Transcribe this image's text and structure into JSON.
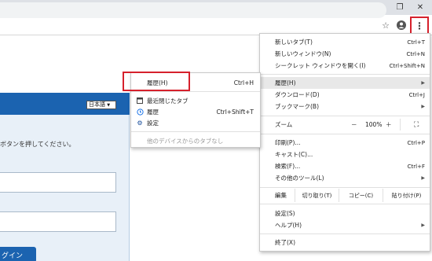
{
  "window": {
    "minimize_icon": "minimize-icon",
    "restore_icon": "restore-icon",
    "close_icon": "close-icon"
  },
  "toolbar": {
    "star_icon": "☆",
    "profile_icon": "●",
    "menu_icon": "⋮"
  },
  "page": {
    "language": "日本語",
    "instruction": "ボタンを押してください。",
    "login_button": "グイン"
  },
  "main_menu": {
    "items": [
      {
        "label": "新しいタブ(T)",
        "shortcut": "Ctrl+T"
      },
      {
        "label": "新しいウィンドウ(N)",
        "shortcut": "Ctrl+N"
      },
      {
        "label": "シークレット ウィンドウを開く(I)",
        "shortcut": "Ctrl+Shift+N"
      },
      {
        "label": "履歴(H)",
        "shortcut": ""
      },
      {
        "label": "ダウンロード(D)",
        "shortcut": "Ctrl+J"
      },
      {
        "label": "ブックマーク(B)",
        "shortcut": ""
      },
      {
        "label": "ズーム",
        "shortcut": ""
      },
      {
        "label": "印刷(P)...",
        "shortcut": "Ctrl+P"
      },
      {
        "label": "キャスト(C)...",
        "shortcut": ""
      },
      {
        "label": "検索(F)...",
        "shortcut": "Ctrl+F"
      },
      {
        "label": "その他のツール(L)",
        "shortcut": ""
      },
      {
        "label": "編集",
        "shortcut": ""
      },
      {
        "label": "設定(S)",
        "shortcut": ""
      },
      {
        "label": "ヘルプ(H)",
        "shortcut": ""
      },
      {
        "label": "終了(X)",
        "shortcut": ""
      }
    ],
    "zoom": {
      "minus": "－",
      "value": "100%",
      "plus": "＋",
      "fullscreen": "⛶"
    },
    "edit": {
      "cut": "切り取り(T)",
      "copy": "コピー(C)",
      "paste": "貼り付け(P)"
    }
  },
  "history_menu": {
    "items": [
      {
        "label": "履歴(H)",
        "shortcut": "Ctrl+H"
      },
      {
        "label": "最近閉じたタブ",
        "shortcut": ""
      },
      {
        "label": "履歴",
        "shortcut": "Ctrl+Shift+T"
      },
      {
        "label": "設定",
        "shortcut": ""
      },
      {
        "label": "他のデバイスからのタブなし",
        "shortcut": ""
      }
    ]
  },
  "colors": {
    "highlight_box": "#d6212c",
    "login_header": "#1b63b0",
    "panel_bg": "#e8f0f8"
  }
}
